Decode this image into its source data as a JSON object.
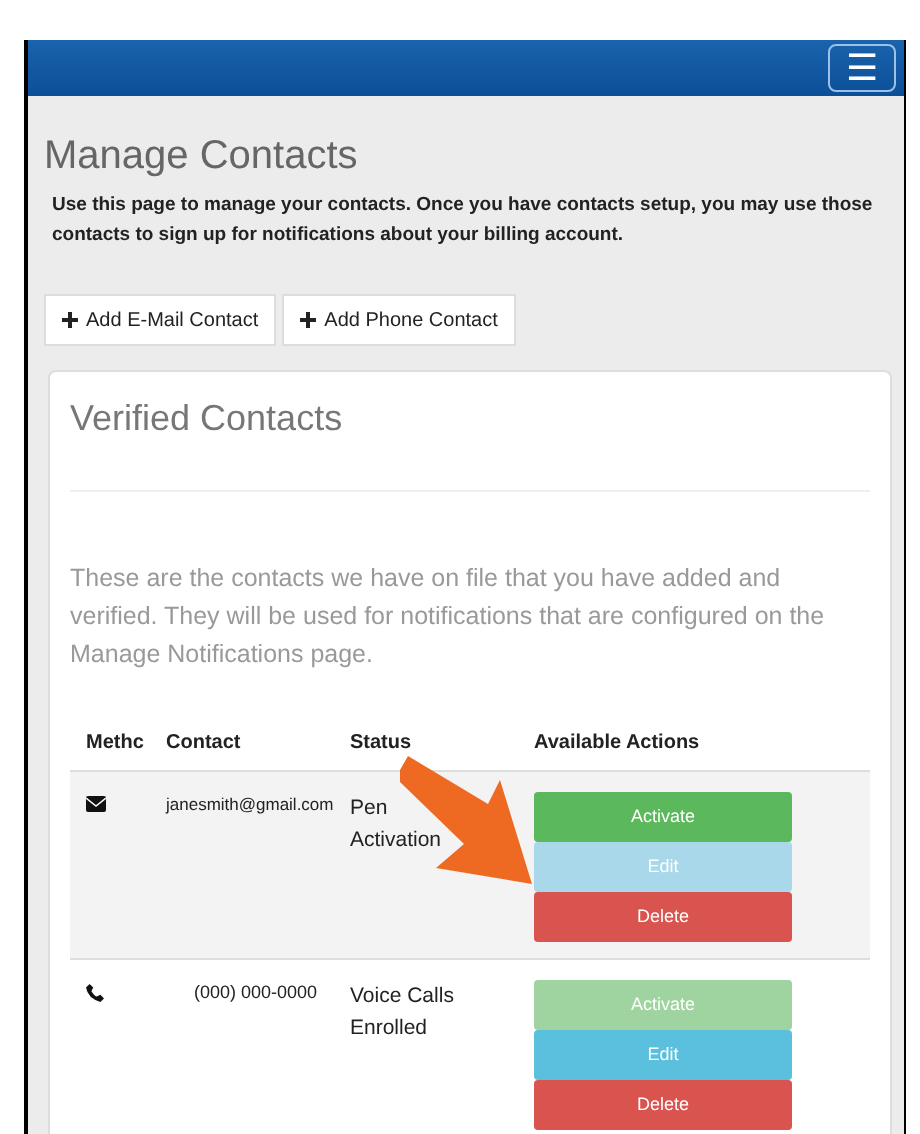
{
  "navbar": {
    "menu_button": "☰"
  },
  "page": {
    "title": "Manage Contacts",
    "description": "Use this page to manage your contacts. Once you have contacts setup, you may use those contacts to sign up for notifications about your billing account."
  },
  "add_buttons": [
    {
      "label": "Add E-Mail Contact"
    },
    {
      "label": "Add Phone Contact"
    }
  ],
  "panel": {
    "title": "Verified Contacts",
    "intro": "These are the contacts we have on file that you have added and verified. They will be used for notifications that are configured on the Manage Notifications page."
  },
  "table": {
    "columns": [
      "Methc",
      "Contact",
      "Status",
      "Available Actions"
    ],
    "rows": [
      {
        "kind": "email",
        "contact": "janesmith@gmail.com",
        "status": [
          "Pen",
          "Activation"
        ],
        "highlighted": true,
        "actions": [
          {
            "kind": "activate",
            "label": "Activate",
            "disabled": false,
            "hover": false
          },
          {
            "kind": "edit",
            "label": "Edit",
            "disabled": false,
            "hover": true
          },
          {
            "kind": "delete",
            "label": "Delete",
            "disabled": false,
            "hover": false
          }
        ]
      },
      {
        "kind": "phone",
        "contact": "(000) 000-0000",
        "status": [
          "Voice Calls",
          "Enrolled"
        ],
        "highlighted": false,
        "actions": [
          {
            "kind": "activate",
            "label": "Activate",
            "disabled": true,
            "hover": false
          },
          {
            "kind": "edit",
            "label": "Edit",
            "disabled": false,
            "hover": false
          },
          {
            "kind": "delete",
            "label": "Delete",
            "disabled": false,
            "hover": false
          }
        ]
      }
    ]
  }
}
